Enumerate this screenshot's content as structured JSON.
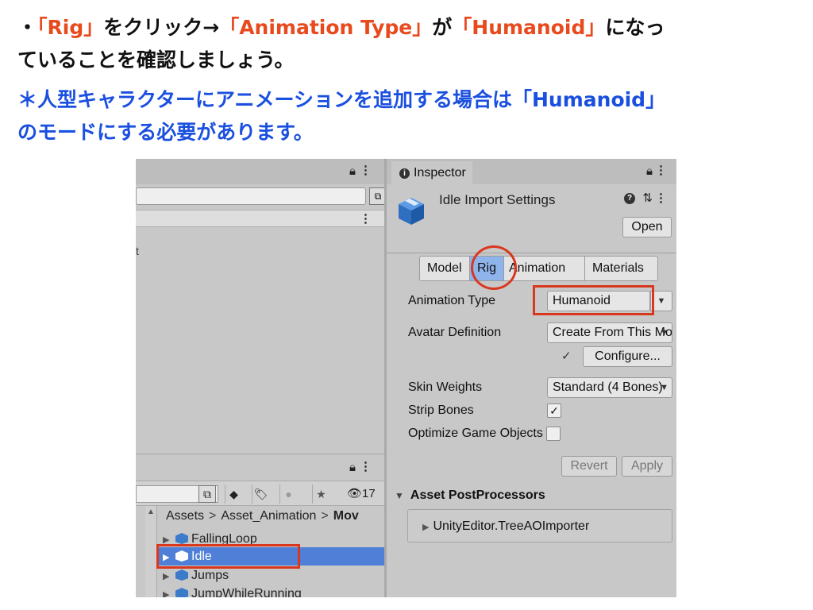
{
  "instructions": {
    "line1": {
      "bullet": "・",
      "rig": "「Rig」",
      "t1": "をクリック→",
      "anim_type": "「Animation Type」",
      "t2": "が",
      "humanoid": "「Humanoid」",
      "t3": "になっ"
    },
    "line2": "ていることを確認しましょう。",
    "line3": "＊人型キャラクターにアニメーションを追加する場合は「Humanoid」",
    "line4": "のモードにする必要があります。"
  },
  "left_panel": {
    "lock": "🔒︎",
    "menu": "⋮",
    "mark": "t"
  },
  "project": {
    "breadcrumb": [
      "Assets",
      "Asset_Animation",
      "Mov"
    ],
    "breadcrumb_sep": ">",
    "count": "👁17",
    "items": [
      {
        "name": "FallingLoop"
      },
      {
        "name": "Idle"
      },
      {
        "name": "Jumps"
      },
      {
        "name": "JumpWhileRunning"
      }
    ]
  },
  "inspector": {
    "tab_label": "Inspector",
    "title": "Idle Import Settings",
    "open_button": "Open",
    "tabs": [
      "Model",
      "Rig",
      "Animation",
      "Materials"
    ],
    "active_tab": "Rig",
    "animation_type_label": "Animation Type",
    "animation_type_value": "Humanoid",
    "avatar_definition_label": "Avatar Definition",
    "avatar_definition_value": "Create From This Model",
    "configure_button": "Configure...",
    "skin_weights_label": "Skin Weights",
    "skin_weights_value": "Standard (4 Bones)",
    "strip_bones_label": "Strip Bones",
    "strip_bones_checked": true,
    "optimize_label": "Optimize Game Objects",
    "optimize_checked": false,
    "revert_button": "Revert",
    "apply_button": "Apply",
    "postprocessors_title": "Asset PostProcessors",
    "postprocessor_item": "UnityEditor.TreeAOImporter"
  },
  "colors": {
    "highlight_text": "#e8491d",
    "note_text": "#1a4fe0",
    "annotation": "#d9381e",
    "active_tab": "#8fb4ec",
    "selected_row": "#4f7fd6"
  }
}
